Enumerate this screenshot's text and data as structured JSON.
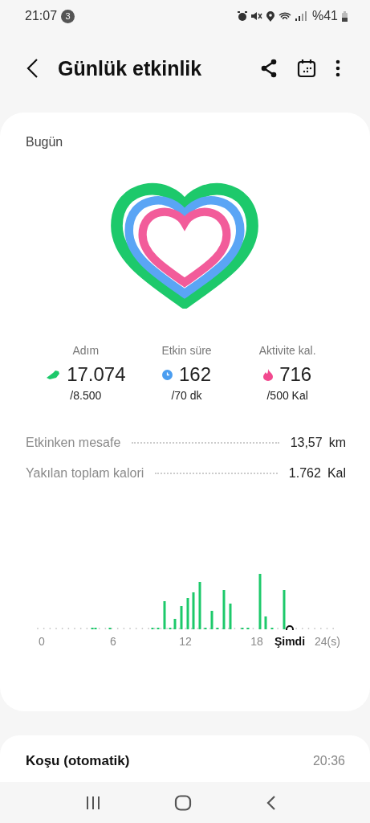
{
  "status_bar": {
    "time": "21:07",
    "notification_count": "3",
    "battery": "%41"
  },
  "header": {
    "title": "Günlük etkinlik"
  },
  "today": {
    "label": "Bugün",
    "stats": [
      {
        "kind": "steps",
        "label": "Adım",
        "value": "17.074",
        "goal": "/8.500"
      },
      {
        "kind": "time",
        "label": "Etkin süre",
        "value": "162",
        "goal": "/70 dk"
      },
      {
        "kind": "calories",
        "label": "Aktivite kal.",
        "value": "716",
        "goal": "/500 Kal"
      }
    ],
    "details": [
      {
        "label": "Etkinken mesafe",
        "value": "13,57",
        "unit": "km"
      },
      {
        "label": "Yakılan toplam kalori",
        "value": "1.762",
        "unit": "Kal"
      }
    ],
    "hour_axis": [
      {
        "label": "0",
        "kind": "tick"
      },
      {
        "label": "6",
        "kind": "tick"
      },
      {
        "label": "12",
        "kind": "tick"
      },
      {
        "label": "18",
        "kind": "tick"
      },
      {
        "label": "Şimdi",
        "kind": "now"
      },
      {
        "label": "24(s)",
        "kind": "tick"
      }
    ]
  },
  "workout": {
    "name": "Koşu (otomatik)",
    "time": "20:36"
  }
}
